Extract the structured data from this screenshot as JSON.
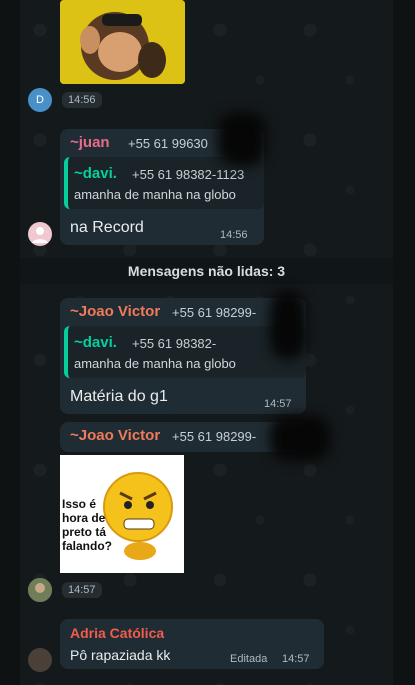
{
  "messages": {
    "m1": {
      "time": "14:56",
      "avatar_letter": "D"
    },
    "m2": {
      "sender": "~juan",
      "phone": "+55 61 99630",
      "quote": {
        "name": "~davi.",
        "phone": "+55 61 98382-1123",
        "text": "amanha de manha na globo"
      },
      "text": "na Record",
      "time": "14:56"
    },
    "unread": "Mensagens não lidas: 3",
    "m3": {
      "sender": "~Joao Victor",
      "phone": "+55 61 98299-",
      "quote": {
        "name": "~davi.",
        "phone": "+55 61 98382-",
        "text": "amanha de manha na globo"
      },
      "text": "Matéria do g1",
      "time": "14:57"
    },
    "m4": {
      "sender": "~Joao Victor",
      "phone": "+55 61 98299-",
      "sticker_text": "Isso é hora de preto tá falando?",
      "time": "14:57"
    },
    "m5": {
      "sender": "Adria Católica",
      "text": "Pô rapaziada kk",
      "edited": "Editada",
      "time": "14:57"
    }
  },
  "colors": {
    "juan": "#e86c8a",
    "joao": "#f07a5a",
    "quote": "#06cf9c",
    "adria": "#f15c4d",
    "bubble": "#202c33"
  }
}
